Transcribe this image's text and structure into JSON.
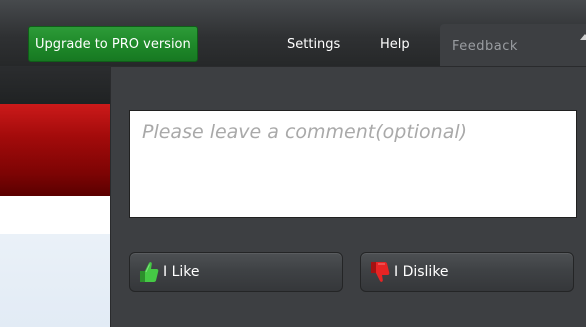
{
  "menu": {
    "upgrade_label": "Upgrade to PRO version",
    "settings_label": "Settings",
    "help_label": "Help",
    "feedback_label": "Feedback"
  },
  "feedback": {
    "comment_placeholder": "Please leave a comment(optional)",
    "like_label": "I Like",
    "dislike_label": "I Dislike"
  },
  "icons": {
    "like": "thumbs-up-icon",
    "dislike": "thumbs-down-icon",
    "caret": "caret-up-icon"
  },
  "colors": {
    "upgrade_green": "#1f8a2a",
    "like_green": "#3fbf3f",
    "dislike_red": "#e01e1e",
    "panel_bg": "#3d3f42",
    "background_red": "#a30b0b"
  }
}
